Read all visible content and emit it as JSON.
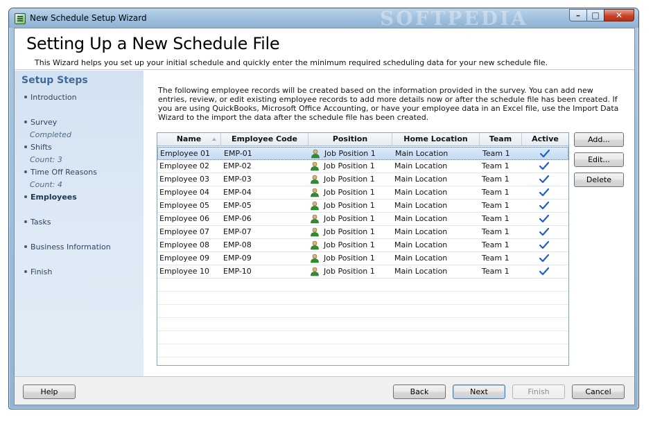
{
  "window": {
    "title": "New Schedule Setup Wizard",
    "watermark": "SOFTPEDIA",
    "controls": {
      "minimize": "–",
      "maximize": "□",
      "close": "✕"
    }
  },
  "header": {
    "title": "Setting Up a New Schedule File",
    "subtitle": "This Wizard helps you set up your initial schedule and quickly enter the minimum required scheduling data for your new schedule file."
  },
  "sidebar": {
    "heading": "Setup Steps",
    "steps": [
      {
        "label": "Introduction",
        "sub": ""
      },
      {
        "label": "Survey",
        "sub": "Completed"
      },
      {
        "label": "Shifts",
        "sub": "Count: 3"
      },
      {
        "label": "Time Off Reasons",
        "sub": "Count: 4"
      },
      {
        "label": "Employees",
        "sub": ""
      },
      {
        "label": "Tasks",
        "sub": ""
      },
      {
        "label": "Business Information",
        "sub": ""
      },
      {
        "label": "Finish",
        "sub": ""
      }
    ]
  },
  "intro_text": "The following employee records will be created based on the information provided in the survey. You can add new entries, review, or edit existing employee records to add more details now or after the schedule file has been created. If you are using QuickBooks, Microsoft Office Accounting, or have your employee data in an Excel file, use the Import Data Wizard to the import the data after the schedule file has been created.",
  "table": {
    "columns": [
      "Name",
      "Employee Code",
      "Position",
      "Home Location",
      "Team",
      "Active"
    ],
    "sorted_column": "Name",
    "rows": [
      {
        "name": "Employee 01",
        "code": "EMP-01",
        "position": "Job Position 1",
        "location": "Main Location",
        "team": "Team 1",
        "active": true
      },
      {
        "name": "Employee 02",
        "code": "EMP-02",
        "position": "Job Position 1",
        "location": "Main Location",
        "team": "Team 1",
        "active": true
      },
      {
        "name": "Employee 03",
        "code": "EMP-03",
        "position": "Job Position 1",
        "location": "Main Location",
        "team": "Team 1",
        "active": true
      },
      {
        "name": "Employee 04",
        "code": "EMP-04",
        "position": "Job Position 1",
        "location": "Main Location",
        "team": "Team 1",
        "active": true
      },
      {
        "name": "Employee 05",
        "code": "EMP-05",
        "position": "Job Position 1",
        "location": "Main Location",
        "team": "Team 1",
        "active": true
      },
      {
        "name": "Employee 06",
        "code": "EMP-06",
        "position": "Job Position 1",
        "location": "Main Location",
        "team": "Team 1",
        "active": true
      },
      {
        "name": "Employee 07",
        "code": "EMP-07",
        "position": "Job Position 1",
        "location": "Main Location",
        "team": "Team 1",
        "active": true
      },
      {
        "name": "Employee 08",
        "code": "EMP-08",
        "position": "Job Position 1",
        "location": "Main Location",
        "team": "Team 1",
        "active": true
      },
      {
        "name": "Employee 09",
        "code": "EMP-09",
        "position": "Job Position 1",
        "location": "Main Location",
        "team": "Team 1",
        "active": true
      },
      {
        "name": "Employee 10",
        "code": "EMP-10",
        "position": "Job Position 1",
        "location": "Main Location",
        "team": "Team 1",
        "active": true
      }
    ],
    "selected_row": 0
  },
  "side_buttons": {
    "add": "Add...",
    "edit": "Edit...",
    "delete": "Delete"
  },
  "footer": {
    "help": "Help",
    "back": "Back",
    "next": "Next",
    "finish": "Finish",
    "cancel": "Cancel"
  },
  "colors": {
    "accent": "#3f6a97",
    "selection": "#c4dcf4",
    "check": "#1f5fc4",
    "person_icon": "#2f8f2f"
  }
}
